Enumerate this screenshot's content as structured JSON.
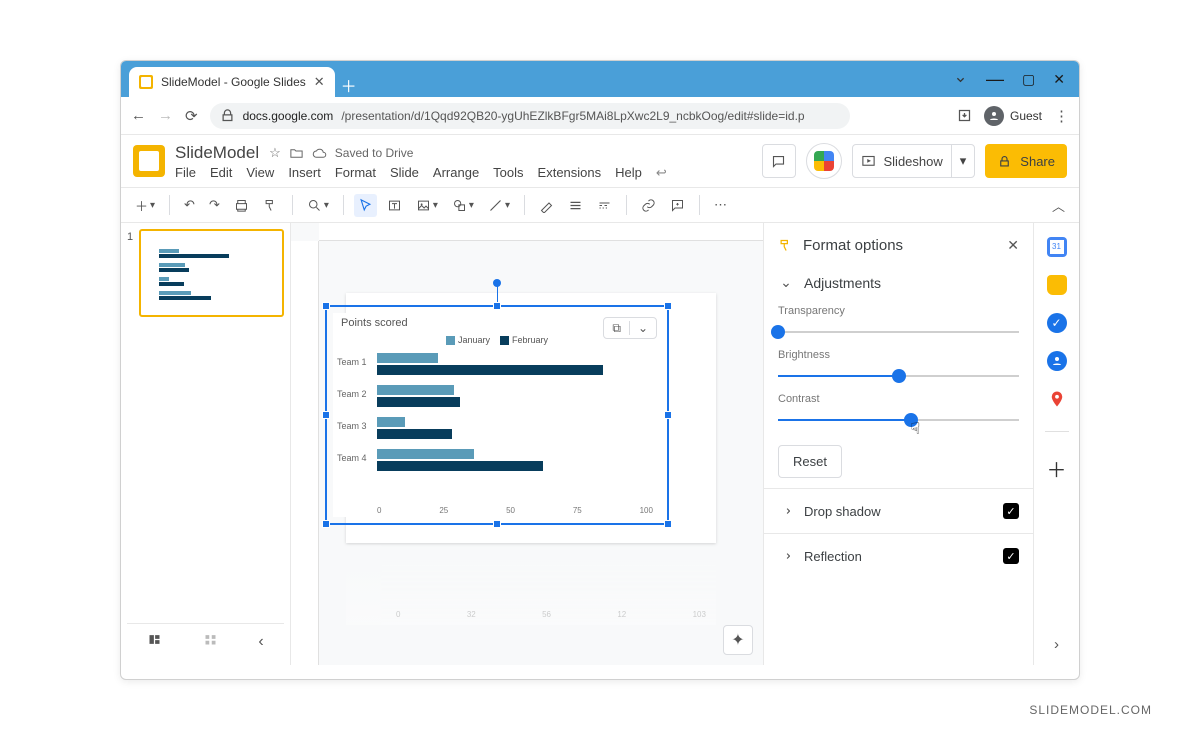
{
  "browser": {
    "tab_title": "SlideModel - Google Slides",
    "url_host": "docs.google.com",
    "url_path": "/presentation/d/1Qqd92QB20-ygUhEZlkBFgr5MAi8LpXwc2L9_ncbkOog/edit#slide=id.p",
    "guest_label": "Guest"
  },
  "app": {
    "title": "SlideModel",
    "saved_label": "Saved to Drive",
    "menu": {
      "file": "File",
      "edit": "Edit",
      "view": "View",
      "insert": "Insert",
      "format": "Format",
      "slide": "Slide",
      "arrange": "Arrange",
      "tools": "Tools",
      "extensions": "Extensions",
      "help": "Help"
    },
    "slideshow_label": "Slideshow",
    "share_label": "Share"
  },
  "thumb": {
    "number": "1"
  },
  "chart_data": {
    "type": "bar",
    "orientation": "horizontal",
    "title": "Points scored",
    "categories": [
      "Team 1",
      "Team 2",
      "Team 3",
      "Team 4"
    ],
    "series": [
      {
        "name": "January",
        "color": "#5a9bb8",
        "values": [
          22,
          28,
          10,
          35
        ]
      },
      {
        "name": "February",
        "color": "#083d5c",
        "values": [
          82,
          30,
          27,
          60
        ]
      }
    ],
    "x_ticks": [
      0,
      25,
      50,
      75,
      100
    ],
    "reflection_ticks": [
      0,
      32,
      56,
      12,
      103
    ],
    "xlim": [
      0,
      100
    ]
  },
  "panel": {
    "title": "Format options",
    "adjustments": {
      "heading": "Adjustments",
      "transparency": {
        "label": "Transparency",
        "value": 0
      },
      "brightness": {
        "label": "Brightness",
        "value": 50
      },
      "contrast": {
        "label": "Contrast",
        "value": 55
      },
      "reset": "Reset"
    },
    "drop_shadow": {
      "label": "Drop shadow",
      "enabled": true
    },
    "reflection": {
      "label": "Reflection",
      "enabled": true
    }
  },
  "watermark": "SLIDEMODEL.COM"
}
